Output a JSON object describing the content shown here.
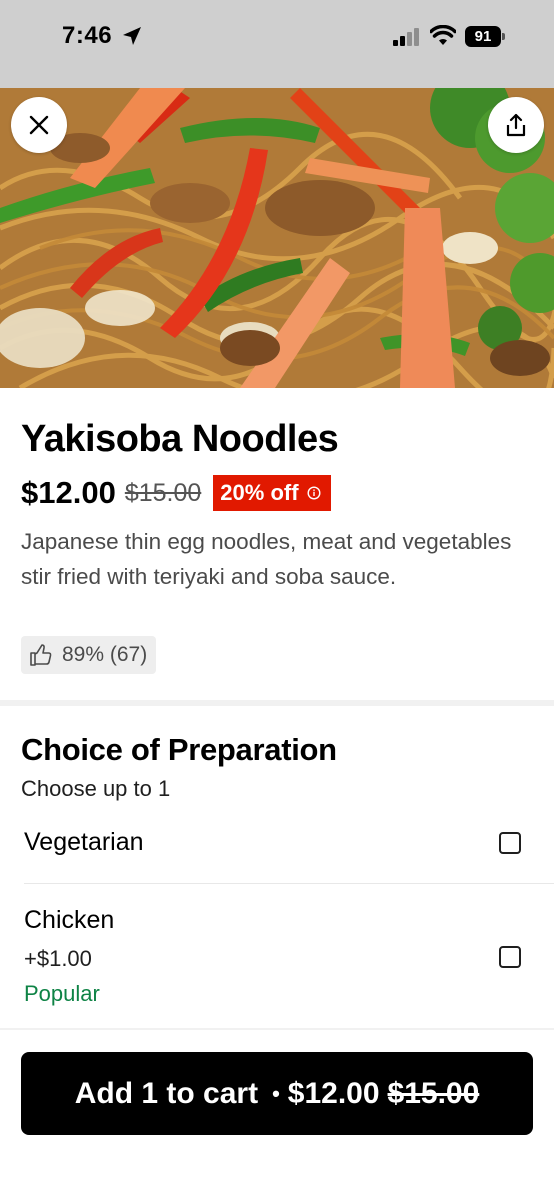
{
  "status_bar": {
    "time": "7:46",
    "battery": "91"
  },
  "icons": {
    "location": "location-arrow-icon",
    "signal": "cellular-signal-icon",
    "wifi": "wifi-icon",
    "close": "close-icon",
    "share": "share-icon",
    "info": "info-icon",
    "thumbs_up": "thumbs-up-icon"
  },
  "item": {
    "title": "Yakisoba Noodles",
    "price": "$12.00",
    "original_price": "$15.00",
    "discount_label": "20% off",
    "description": "Japanese thin egg noodles, meat and vegetables stir fried with teriyaki and soba sauce.",
    "rating": "89% (67)"
  },
  "preparation": {
    "title": "Choice of Preparation",
    "subtitle": "Choose up to 1",
    "options": [
      {
        "name": "Vegetarian",
        "checked": false
      },
      {
        "name": "Chicken",
        "price": "+$1.00",
        "tag": "Popular",
        "checked": false
      }
    ]
  },
  "cart_button": {
    "label": "Add 1 to cart",
    "separator": "•",
    "price": "$12.00",
    "original_price": "$15.00"
  },
  "colors": {
    "discount_bg": "#e11900",
    "popular_text": "#0e8345",
    "cart_button_bg": "#000000"
  }
}
